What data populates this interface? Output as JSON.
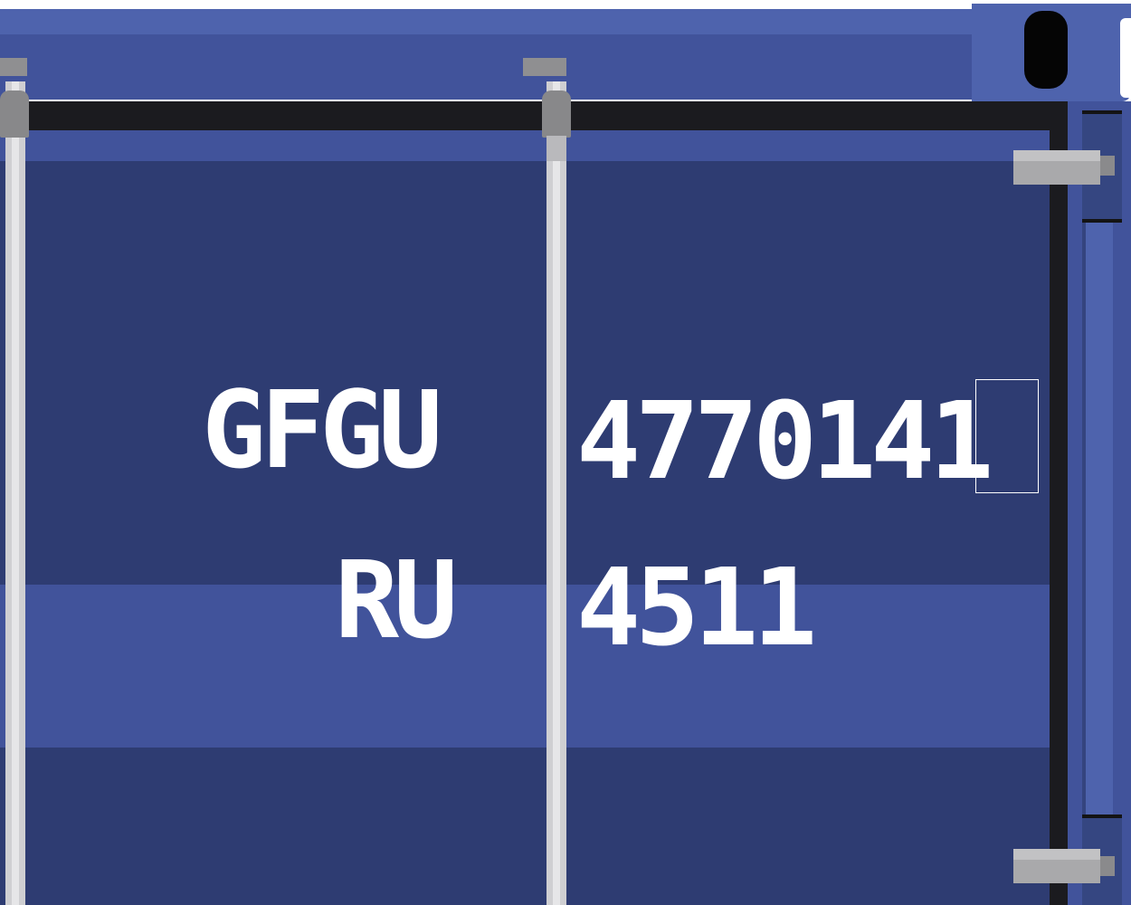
{
  "container": {
    "color": "#2e3c72",
    "accent_color": "#4e63ad",
    "marking_color": "#ffffff"
  },
  "markings": {
    "owner_code": "GFGU",
    "serial_number": "477014",
    "check_digit": "1",
    "size_type_prefix": "RU",
    "size_type_code": "4511"
  }
}
